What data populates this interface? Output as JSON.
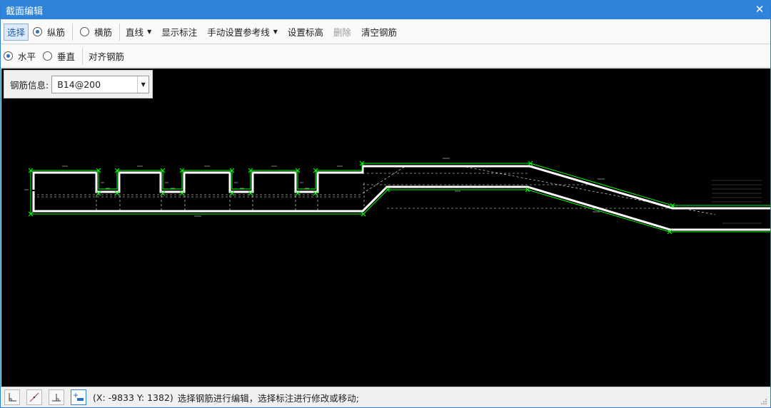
{
  "window": {
    "title": "截面编辑",
    "close_label": "✕"
  },
  "toolbar1": {
    "select_label": "选择",
    "radio_longitudinal": "纵筋",
    "radio_transverse": "横筋",
    "line_label": "直线",
    "show_annotation_label": "显示标注",
    "manual_ref_line_label": "手动设置参考线",
    "set_elevation_label": "设置标高",
    "delete_label": "删除",
    "clear_rebar_label": "清空钢筋",
    "longitudinal_selected": true
  },
  "toolbar2": {
    "radio_horizontal": "水平",
    "radio_vertical": "垂直",
    "align_rebar_label": "对齐钢筋",
    "horizontal_selected": true
  },
  "info_panel": {
    "label": "钢筋信息:",
    "rebar_value": "B14@200"
  },
  "statusbar": {
    "coords_text": "(X: -9833 Y: 1382)",
    "message": "选择钢筋进行编辑，选择标注进行修改或移动;",
    "buttons": [
      "orthogonal-mode",
      "angle-mode",
      "perpendicular-mode",
      "add-annotation-mode"
    ],
    "active_button": "add-annotation-mode"
  },
  "colors": {
    "titlebar": "#2f83db",
    "canvas_bg": "#000000",
    "section_outline": "#00ff00",
    "rebar": "#ffffff"
  }
}
